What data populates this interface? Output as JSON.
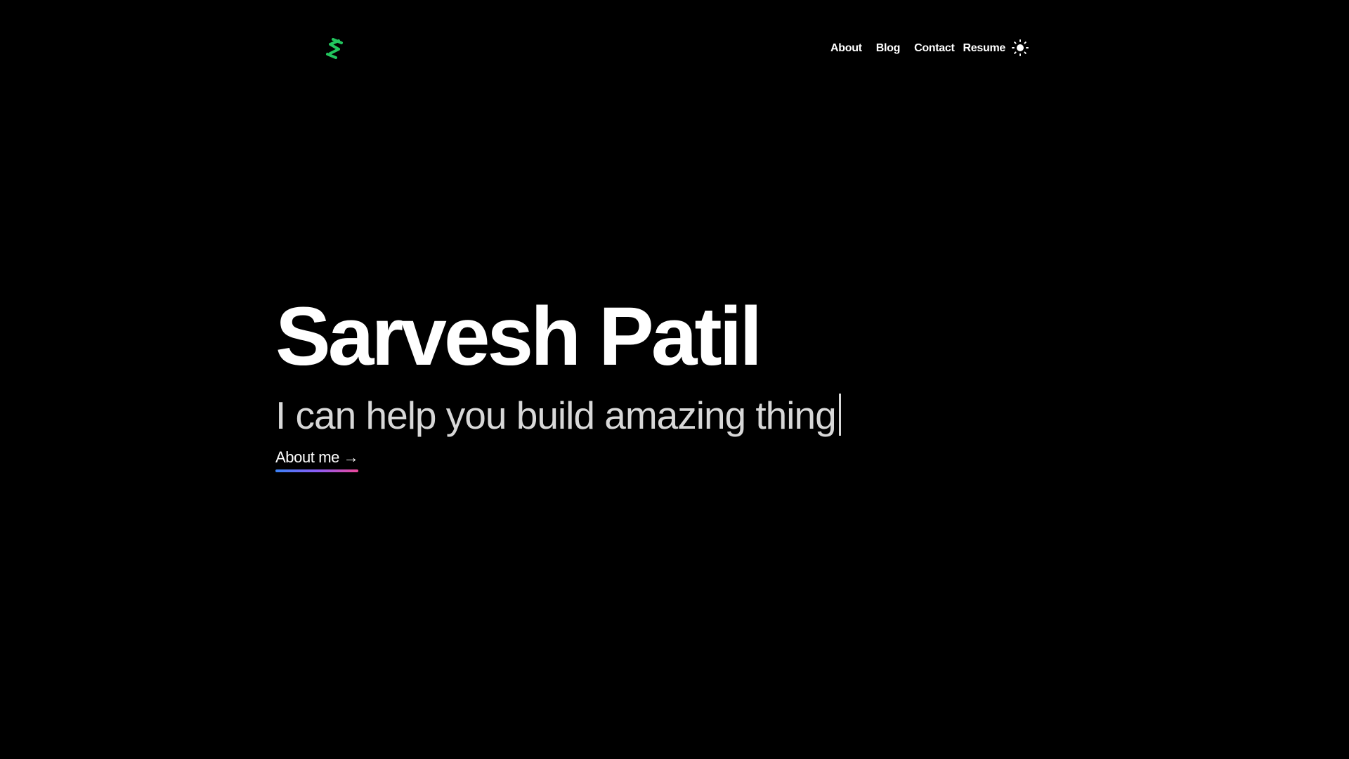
{
  "header": {
    "logo_icon": "s-logo-icon",
    "nav": {
      "about": "About",
      "blog": "Blog",
      "contact": "Contact",
      "resume": "Resume"
    },
    "theme_toggle_icon": "sun-icon"
  },
  "hero": {
    "name": "Sarvesh Patil",
    "tagline": "I can help you build amazing thing",
    "cta_label": "About me →"
  },
  "colors": {
    "background": "#000000",
    "text": "#ffffff",
    "tagline": "#d8d8d8",
    "logo_green": "#22c55e",
    "underline_start": "#3b82f6",
    "underline_mid": "#8b5cf6",
    "underline_end": "#ec4899"
  }
}
